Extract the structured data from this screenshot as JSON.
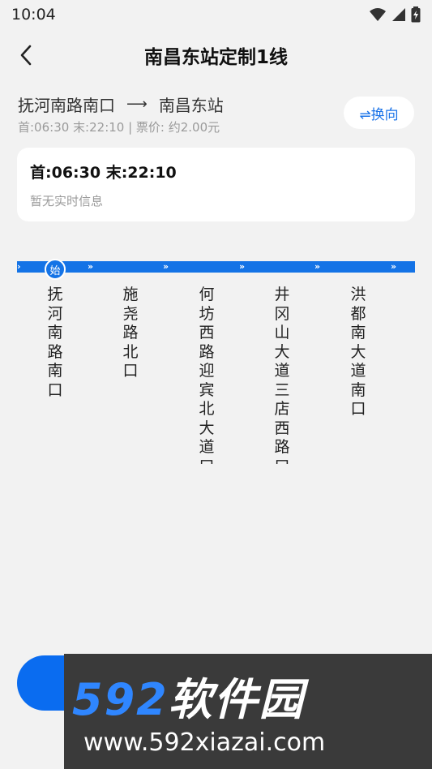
{
  "status_bar": {
    "time": "10:04"
  },
  "header": {
    "title": "南昌东站定制1线"
  },
  "route": {
    "from": "抚河南路南口",
    "arrow": "⟶",
    "to": "南昌东站",
    "meta": "首:06:30 末:22:10 | 票价: 约2.00元",
    "reverse_label": "⇌换向"
  },
  "card": {
    "time_text": "首:06:30 末:22:10",
    "status_text": "暂无实时信息"
  },
  "line": {
    "start_badge": "始",
    "color": "#1473e6",
    "stops": [
      "抚河南路南口",
      "施尧路北口",
      "何坊西路迎宾北大道口",
      "井冈山大道三店西路口",
      "洪都南大道南口"
    ]
  },
  "watermark": {
    "brand_num": "592",
    "brand_text": "软件园",
    "url": "www.592xiazai.com"
  }
}
